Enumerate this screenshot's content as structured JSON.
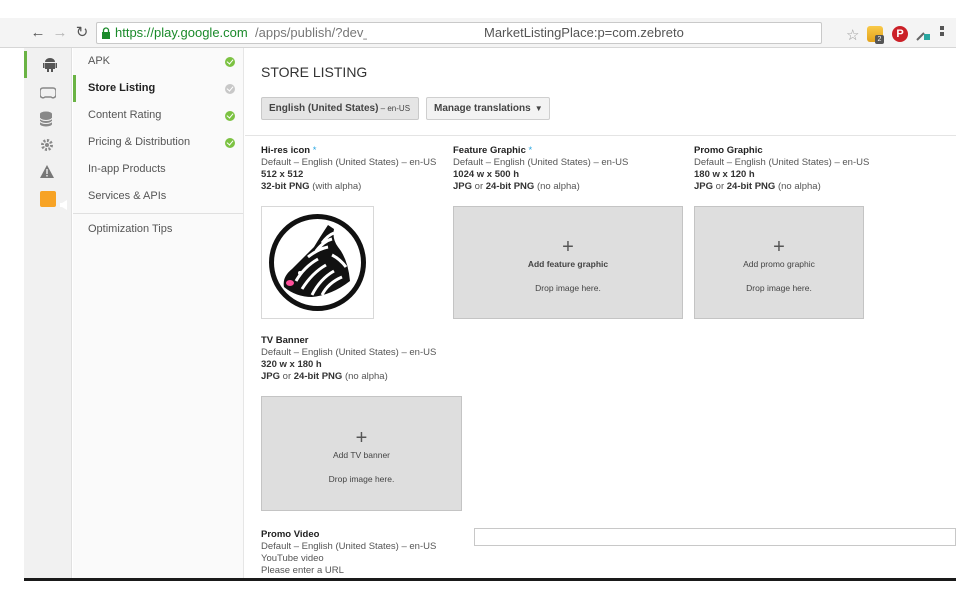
{
  "browser": {
    "url_secure": "https://play.google.com",
    "url_rest": "/apps/publish/?dev_acc=",
    "url_right": "MarketListingPlace:p=com.zebreto",
    "ext_badge": "2",
    "pinterest": "P"
  },
  "rail": {
    "items": [
      "android-icon",
      "gamepad-icon",
      "database-icon",
      "gear-icon",
      "alert-icon",
      "megaphone-icon"
    ]
  },
  "sidebar": {
    "items": [
      {
        "label": "APK",
        "status": "complete"
      },
      {
        "label": "Store Listing",
        "status": "incomplete"
      },
      {
        "label": "Content Rating",
        "status": "complete"
      },
      {
        "label": "Pricing & Distribution",
        "status": "complete"
      },
      {
        "label": "In-app Products"
      },
      {
        "label": "Services & APIs"
      },
      {
        "label": "Optimization Tips"
      }
    ]
  },
  "main": {
    "title": "STORE LISTING",
    "lang_button": "English (United States)",
    "lang_code": " – en-US",
    "translations_button": "Manage translations",
    "assets": {
      "hires": {
        "title": "Hi-res icon",
        "req": " *",
        "default": "Default – English (United States) – en-US",
        "dims": "512 x 512",
        "format_bold": "32-bit PNG",
        "format_rest": " (with alpha)"
      },
      "feature": {
        "title": "Feature Graphic",
        "req": " *",
        "default": "Default – English (United States) – en-US",
        "dims": "1024 w x 500 h",
        "fmt1": "JPG",
        "or": " or ",
        "fmt2": "24-bit PNG",
        "fmt_rest": " (no alpha)",
        "add": "Add feature graphic",
        "drop": "Drop image here."
      },
      "promo": {
        "title": "Promo Graphic",
        "default": "Default – English (United States) – en-US",
        "dims": "180 w x 120 h",
        "fmt1": "JPG",
        "or": " or ",
        "fmt2": "24-bit PNG",
        "fmt_rest": " (no alpha)",
        "add": "Add promo graphic",
        "drop": "Drop image here."
      },
      "tv": {
        "title": "TV Banner",
        "default": "Default – English (United States) – en-US",
        "dims": "320 w x 180 h",
        "fmt1": "JPG",
        "or": " or ",
        "fmt2": "24-bit PNG",
        "fmt_rest": " (no alpha)",
        "add": "Add TV banner",
        "drop": "Drop image here."
      },
      "video": {
        "title": "Promo Video",
        "default": "Default – English (United States) – en-US",
        "line2": "YouTube video",
        "line3": "Please enter a URL",
        "value": ""
      }
    }
  },
  "colors": {
    "accent": "#6ab344",
    "required": "#2aa7e2",
    "check": "#7cc242"
  }
}
